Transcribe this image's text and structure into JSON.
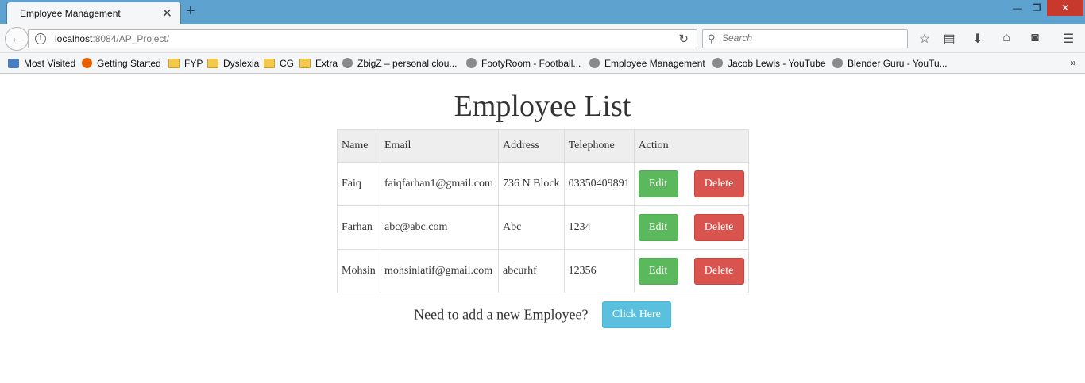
{
  "browser": {
    "tab_title": "Employee Management",
    "url_host": "localhost",
    "url_rest": ":8084/AP_Project/",
    "search_placeholder": "Search"
  },
  "bookmarks": [
    {
      "label": "Most Visited",
      "icon": "most-visited-icon"
    },
    {
      "label": "Getting Started",
      "icon": "firefox-icon"
    },
    {
      "label": "FYP",
      "icon": "folder-icon"
    },
    {
      "label": "Dyslexia",
      "icon": "folder-icon"
    },
    {
      "label": "CG",
      "icon": "folder-icon"
    },
    {
      "label": "Extra",
      "icon": "folder-icon"
    },
    {
      "label": "ZbigZ – personal clou...",
      "icon": "globe-icon"
    },
    {
      "label": "FootyRoom - Football...",
      "icon": "globe-icon"
    },
    {
      "label": "Employee Management",
      "icon": "globe-icon"
    },
    {
      "label": "Jacob Lewis - YouTube",
      "icon": "globe-icon"
    },
    {
      "label": "Blender Guru - YouTu...",
      "icon": "globe-icon"
    }
  ],
  "page": {
    "title": "Employee List",
    "columns": [
      "Name",
      "Email",
      "Address",
      "Telephone",
      "Action"
    ],
    "rows": [
      {
        "name": "Faiq",
        "email": "faiqfarhan1@gmail.com",
        "address": "736 N Block",
        "telephone": "03350409891"
      },
      {
        "name": "Farhan",
        "email": "abc@abc.com",
        "address": "Abc",
        "telephone": "1234"
      },
      {
        "name": "Mohsin",
        "email": "mohsinlatif@gmail.com",
        "address": "abcurhf",
        "telephone": "12356"
      }
    ],
    "edit_label": "Edit",
    "delete_label": "Delete",
    "add_prompt": "Need to add a new Employee?",
    "add_button": "Click Here"
  },
  "colors": {
    "edit": "#5cb85c",
    "delete": "#d9534f",
    "add": "#5bc0de",
    "tabstrip": "#5ea3d0"
  }
}
